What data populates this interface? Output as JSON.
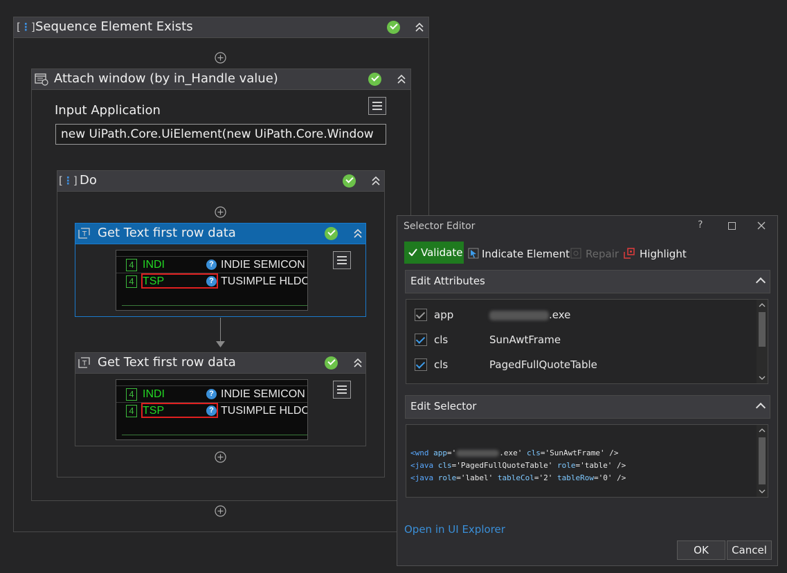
{
  "workflow": {
    "sequence_title": "Sequence Element Exists",
    "attach": {
      "title": "Attach window (by in_Handle value)",
      "input_label": "Input Application",
      "input_value": "new UiPath.Core.UiElement(new UiPath.Core.Window"
    },
    "do": {
      "title": "Do"
    },
    "get_text_1": {
      "title": "Get Text first row data"
    },
    "get_text_2": {
      "title": "Get Text first row data"
    },
    "screenshot_rows": [
      {
        "num": "4",
        "symbol": "INDI",
        "name": "INDIE SEMICON"
      },
      {
        "num": "4",
        "symbol": "TSP",
        "name": "TUSIMPLE HLDC"
      }
    ]
  },
  "selector_editor": {
    "title": "Selector Editor",
    "help": "?",
    "toolbar": {
      "validate": "Validate",
      "indicate": "Indicate Element",
      "repair": "Repair",
      "highlight": "Highlight"
    },
    "edit_attributes_label": "Edit Attributes",
    "attributes": [
      {
        "name": "app",
        "value_suffix": ".exe"
      },
      {
        "name": "cls",
        "value": "SunAwtFrame"
      },
      {
        "name": "cls",
        "value": "PagedFullQuoteTable"
      }
    ],
    "edit_selector_label": "Edit Selector",
    "selector_lines": {
      "l1_tag": "<wnd",
      "l1_app_attr": "app",
      "l1_app_val_pre": "='",
      "l1_app_val_post": ".exe'",
      "l1_cls_attr": "cls",
      "l1_cls_val": "='SunAwtFrame' />",
      "l2_tag": "<java",
      "l2_cls_attr": "cls",
      "l2_cls_val": "='PagedFullQuoteTable'",
      "l2_role_attr": "role",
      "l2_role_val": "='table' />",
      "l3_tag": "<java",
      "l3_role_attr": "role",
      "l3_role_val": "='label'",
      "l3_col_attr": "tableCol",
      "l3_col_val": "='2'",
      "l3_row_attr": "tableRow",
      "l3_row_val": "='0' />"
    },
    "open_explorer": "Open in UI Explorer",
    "ok": "OK",
    "cancel": "Cancel"
  },
  "colors": {
    "background": "#252526",
    "header": "#3c3c40",
    "selected_header": "#1166aa",
    "validate_green": "#1f7a1f",
    "link_blue": "#3a8fd8",
    "status_green": "#6cc24a",
    "highlight_red": "#e02020"
  }
}
